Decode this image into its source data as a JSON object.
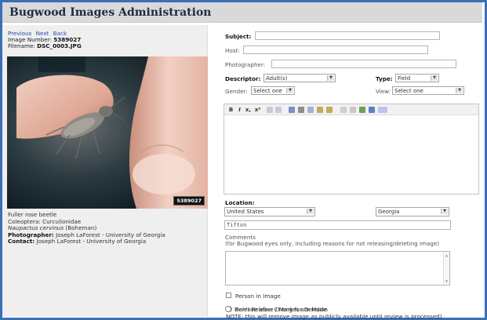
{
  "app": {
    "title": "Bugwood Images Administration"
  },
  "nav": {
    "previous": "Previous",
    "next": "Next",
    "back": "Back"
  },
  "image": {
    "number_label": "Image Number:",
    "number_value": "5389027",
    "filename_label": "Filename:",
    "filename_value": "DSC_0003.JPG",
    "badge": "5389027"
  },
  "caption": {
    "common_name": "Fuller rose beetle",
    "order_family": "Coleoptera: Curculionidae",
    "scientific_name": "Naupactus cervinus",
    "authority": "(Boheman)",
    "photographer_label": "Photographer:",
    "photographer_value": "Joseph LaForest - University of Georgia",
    "contact_label": "Contact:",
    "contact_value": "Joseph LaForest - University of Georgia"
  },
  "form": {
    "subject_label": "Subject:",
    "subject_value": "",
    "host_label": "Host:",
    "host_value": "",
    "photographer_label": "Photographer:",
    "photographer_value": "",
    "descriptor_label": "Descriptor:",
    "descriptor_value": "Adult(s)",
    "type_label": "Type:",
    "type_value": "Field",
    "gender_label": "Gender:",
    "gender_value": "Select one",
    "view_label": "View:",
    "view_value": "Select one",
    "location_label": "Location:",
    "country_value": "United States",
    "state_value": "Georgia",
    "county_value": "Tifton",
    "comments_label": "Comments",
    "comments_note": "(for Bugwood eyes only, including reasons for not releasing/deleting image)",
    "person_in_image_label": "Person in Image",
    "release_label": "Release after Changes are Made",
    "release_note": "NOTE: this will remove image as publicly available until review is processed)",
    "dont_release_label": "Don't Release / Mark for Deletion"
  },
  "editor": {
    "bold": "B",
    "italic": "I",
    "subscript": "x,",
    "superscript": "x²"
  },
  "colors": {
    "frame": "#3b6fb8",
    "header_bg": "#d9d9d9",
    "title": "#1d2b46",
    "link": "#2e47b8"
  }
}
